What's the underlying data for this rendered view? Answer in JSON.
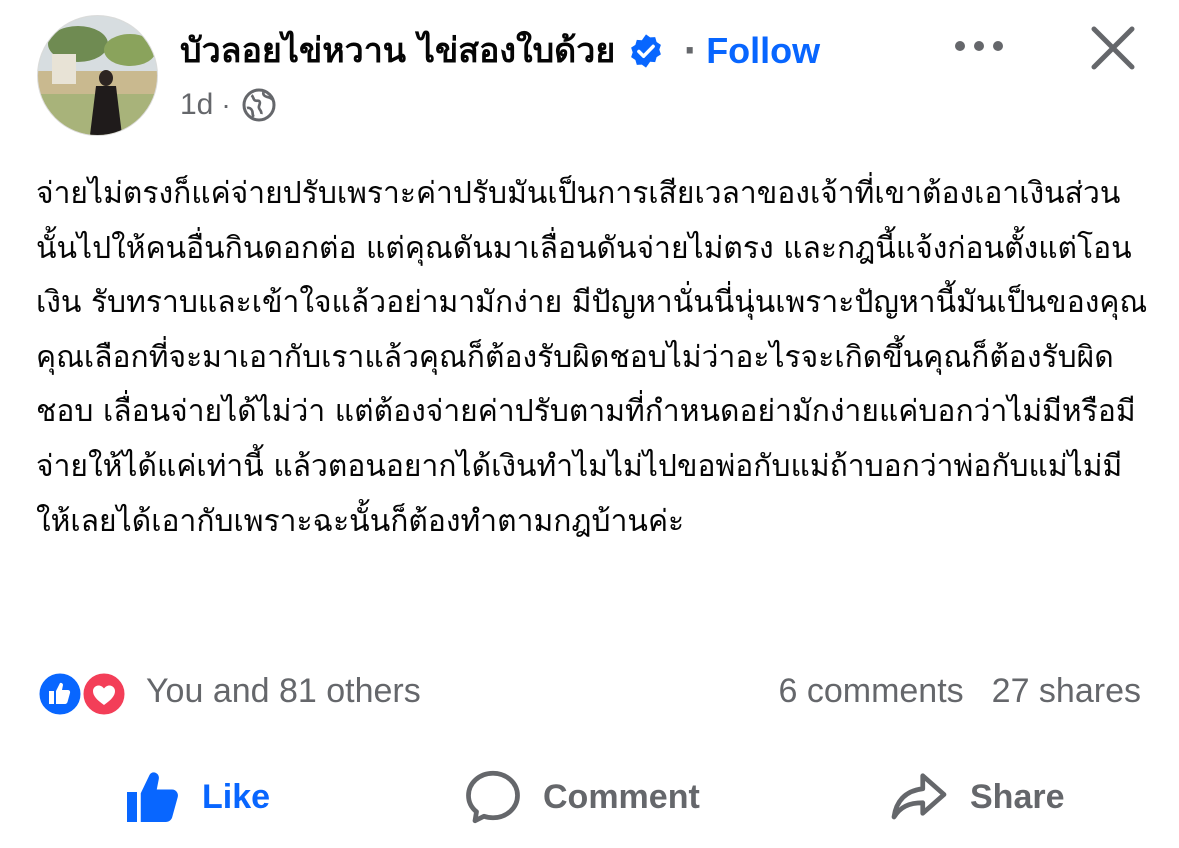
{
  "post": {
    "author": "บัวลอยไข่หวาน ไข่สองใบด้วย",
    "follow_label": "Follow",
    "separator": "·",
    "time": "1d",
    "text": "จ่ายไม่ตรงก็แค่จ่ายปรับเพราะค่าปรับมันเป็นการเสียเวลาของเจ้าที่เขาต้องเอาเงินส่วนนั้นไปให้คนอื่นกินดอกต่อ แต่คุณดันมาเลื่อนดันจ่ายไม่ตรง  และกฎนี้แจ้งก่อนตั้งแต่โอนเงิน รับทราบและเข้าใจแล้วอย่ามามักง่าย มีปัญหานั่นนี่นุ่นเพราะปัญหานี้มันเป็นของคุณ  คุณเลือกที่จะมาเอากับเราแล้วคุณก็ต้องรับผิดชอบไม่ว่าอะไรจะเกิดขึ้นคุณก็ต้องรับผิดชอบ เลื่อนจ่ายได้ไม่ว่า แต่ต้องจ่ายค่าปรับตามที่กำหนดอย่ามักง่ายแค่บอกว่าไม่มีหรือมีจ่ายให้ได้แค่เท่านี้  แล้วตอนอยากได้เงินทำไมไม่ไปขอพ่อกับแม่ถ้าบอกว่าพ่อกับแม่ไม่มีให้เลยได้เอากับเพราะฉะนั้นก็ต้องทำตามกฎบ้านค่ะ"
  },
  "engagement": {
    "reactions_summary": "You and 81 others",
    "comments": "6 comments",
    "shares": "27 shares"
  },
  "actions": {
    "like": "Like",
    "comment": "Comment",
    "share": "Share"
  },
  "icons": {
    "verified": "verified-badge-icon",
    "more": "more-dots-icon",
    "close": "close-icon",
    "audience": "globe-icon",
    "like_reaction": "like-reaction-icon",
    "love_reaction": "love-reaction-icon"
  },
  "colors": {
    "accent": "#0866ff",
    "secondary_text": "#65676b",
    "love": "#f33e58"
  }
}
